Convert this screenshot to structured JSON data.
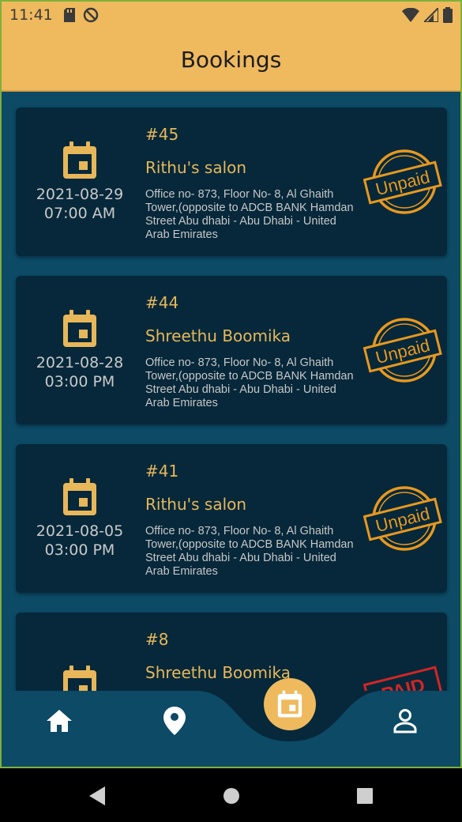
{
  "status_bar": {
    "time": "11:41"
  },
  "app_bar": {
    "title": "Bookings"
  },
  "bookings": [
    {
      "id": "#45",
      "date": "2021-08-29",
      "time": "07:00 AM",
      "salon": "Rithu's salon",
      "address": "Office no- 873, Floor No- 8, Al Ghaith Tower,(opposite to ADCB BANK Hamdan Street Abu dhabi - Abu Dhabi - United Arab Emirates",
      "status": "Unpaid"
    },
    {
      "id": "#44",
      "date": "2021-08-28",
      "time": "03:00 PM",
      "salon": "Shreethu Boomika",
      "address": "Office no- 873, Floor No- 8, Al Ghaith Tower,(opposite to ADCB BANK Hamdan Street Abu dhabi - Abu Dhabi - United Arab Emirates",
      "status": "Unpaid"
    },
    {
      "id": "#41",
      "date": "2021-08-05",
      "time": "03:00 PM",
      "salon": "Rithu's salon",
      "address": "Office no- 873, Floor No- 8, Al Ghaith Tower,(opposite to ADCB BANK Hamdan Street Abu dhabi - Abu Dhabi - United Arab Emirates",
      "status": "Unpaid"
    },
    {
      "id": "#8",
      "date": "",
      "time": "",
      "salon": "Shreethu Boomika",
      "address": "",
      "status": "PAID"
    }
  ],
  "bottom_nav": {
    "items": [
      "home-icon",
      "location-pin-icon",
      "calendar-icon",
      "person-icon"
    ],
    "active": "calendar-icon"
  },
  "colors": {
    "accent": "#efb95e",
    "background": "#0c4a66",
    "card": "#06283a",
    "unpaid_stamp": "#e8981f",
    "paid_stamp": "#d32525"
  }
}
